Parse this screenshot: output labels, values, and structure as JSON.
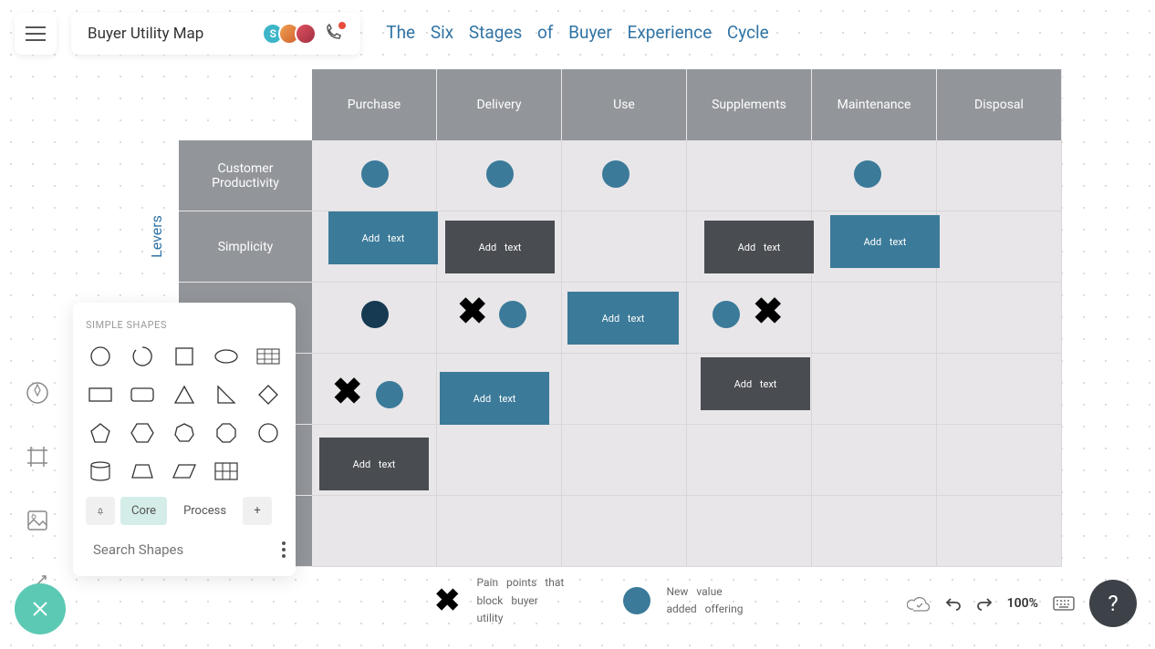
{
  "title": "Buyer Utility Map",
  "heading": "The Six Stages of Buyer Experience Cycle",
  "avatar_letter": "S",
  "columns": [
    "Purchase",
    "Delivery",
    "Use",
    "Supplements",
    "Maintenance",
    "Disposal"
  ],
  "rows": [
    "Customer Productivity",
    "Simplicity",
    "",
    "",
    "",
    ""
  ],
  "levers_label": "Levers",
  "callouts": {
    "c1": "Add text",
    "c2": "Add text",
    "c3": "Add text",
    "c4": "Add text",
    "c5": "Add text",
    "c6": "Add text",
    "c7": "Add text",
    "c8": "Add text"
  },
  "legend": {
    "pain": "Pain points that block buyer utility",
    "new": "New value added offering"
  },
  "shapes_panel": {
    "title": "SIMPLE SHAPES",
    "tabs": {
      "core": "Core",
      "process": "Process",
      "plus": "+"
    },
    "search_placeholder": "Search Shapes"
  },
  "zoom": "100%",
  "help": "?"
}
